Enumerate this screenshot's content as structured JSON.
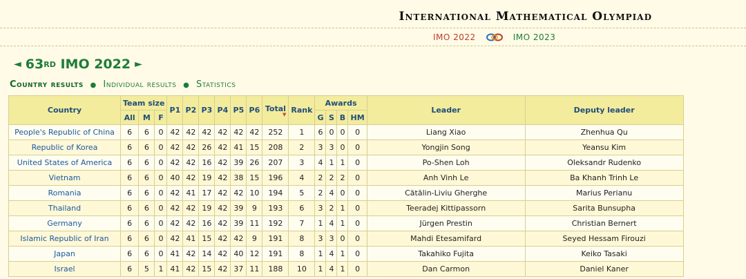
{
  "site_title": "International Mathematical Olympiad",
  "edition_nav": {
    "prev": "IMO 2022",
    "next": "IMO 2023"
  },
  "edition": {
    "ordinal": "63",
    "suffix": "RD",
    "label": "IMO 2022",
    "prev_arrow": "◄",
    "next_arrow": "►"
  },
  "section_nav": {
    "current": "Country results",
    "items": [
      "Individual results",
      "Statistics"
    ],
    "separator": "●"
  },
  "table": {
    "headers": {
      "country": "Country",
      "team_size": "Team size",
      "all": "All",
      "m": "M",
      "f": "F",
      "p1": "P1",
      "p2": "P2",
      "p3": "P3",
      "p4": "P4",
      "p5": "P5",
      "p6": "P6",
      "total": "Total",
      "rank": "Rank",
      "awards": "Awards",
      "g": "G",
      "s": "S",
      "b": "B",
      "hm": "HM",
      "leader": "Leader",
      "deputy": "Deputy leader"
    },
    "sort_marker": "▼",
    "rows": [
      {
        "country": "People's Republic of China",
        "all": "6",
        "m": "6",
        "f": "0",
        "p1": "42",
        "p2": "42",
        "p3": "42",
        "p4": "42",
        "p5": "42",
        "p6": "42",
        "total": "252",
        "rank": "1",
        "g": "6",
        "s": "0",
        "b": "0",
        "hm": "0",
        "leader": "Liang Xiao",
        "deputy": "Zhenhua Qu"
      },
      {
        "country": "Republic of Korea",
        "all": "6",
        "m": "6",
        "f": "0",
        "p1": "42",
        "p2": "42",
        "p3": "26",
        "p4": "42",
        "p5": "41",
        "p6": "15",
        "total": "208",
        "rank": "2",
        "g": "3",
        "s": "3",
        "b": "0",
        "hm": "0",
        "leader": "Yongjin Song",
        "deputy": "Yeansu Kim"
      },
      {
        "country": "United States of America",
        "all": "6",
        "m": "6",
        "f": "0",
        "p1": "42",
        "p2": "42",
        "p3": "16",
        "p4": "42",
        "p5": "39",
        "p6": "26",
        "total": "207",
        "rank": "3",
        "g": "4",
        "s": "1",
        "b": "1",
        "hm": "0",
        "leader": "Po-Shen Loh",
        "deputy": "Oleksandr Rudenko"
      },
      {
        "country": "Vietnam",
        "all": "6",
        "m": "6",
        "f": "0",
        "p1": "40",
        "p2": "42",
        "p3": "19",
        "p4": "42",
        "p5": "38",
        "p6": "15",
        "total": "196",
        "rank": "4",
        "g": "2",
        "s": "2",
        "b": "2",
        "hm": "0",
        "leader": "Anh Vinh Le",
        "deputy": "Ba Khanh Trinh Le"
      },
      {
        "country": "Romania",
        "all": "6",
        "m": "6",
        "f": "0",
        "p1": "42",
        "p2": "41",
        "p3": "17",
        "p4": "42",
        "p5": "42",
        "p6": "10",
        "total": "194",
        "rank": "5",
        "g": "2",
        "s": "4",
        "b": "0",
        "hm": "0",
        "leader": "Cătălin-Liviu Gherghe",
        "deputy": "Marius Perianu"
      },
      {
        "country": "Thailand",
        "all": "6",
        "m": "6",
        "f": "0",
        "p1": "42",
        "p2": "42",
        "p3": "19",
        "p4": "42",
        "p5": "39",
        "p6": "9",
        "total": "193",
        "rank": "6",
        "g": "3",
        "s": "2",
        "b": "1",
        "hm": "0",
        "leader": "Teeradej Kittipassorn",
        "deputy": "Sarita Bunsupha"
      },
      {
        "country": "Germany",
        "all": "6",
        "m": "6",
        "f": "0",
        "p1": "42",
        "p2": "42",
        "p3": "16",
        "p4": "42",
        "p5": "39",
        "p6": "11",
        "total": "192",
        "rank": "7",
        "g": "1",
        "s": "4",
        "b": "1",
        "hm": "0",
        "leader": "Jürgen Prestin",
        "deputy": "Christian Bernert"
      },
      {
        "country": "Islamic Republic of Iran",
        "all": "6",
        "m": "6",
        "f": "0",
        "p1": "42",
        "p2": "41",
        "p3": "15",
        "p4": "42",
        "p5": "42",
        "p6": "9",
        "total": "191",
        "rank": "8",
        "g": "3",
        "s": "3",
        "b": "0",
        "hm": "0",
        "leader": "Mahdi Etesamifard",
        "deputy": "Seyed Hessam Firouzi"
      },
      {
        "country": "Japan",
        "all": "6",
        "m": "6",
        "f": "0",
        "p1": "41",
        "p2": "42",
        "p3": "14",
        "p4": "42",
        "p5": "40",
        "p6": "12",
        "total": "191",
        "rank": "8",
        "g": "1",
        "s": "4",
        "b": "1",
        "hm": "0",
        "leader": "Takahiko Fujita",
        "deputy": "Keiko Tasaki"
      },
      {
        "country": "Israel",
        "all": "6",
        "m": "5",
        "f": "1",
        "p1": "41",
        "p2": "42",
        "p3": "15",
        "p4": "42",
        "p5": "37",
        "p6": "11",
        "total": "188",
        "rank": "10",
        "g": "1",
        "s": "4",
        "b": "1",
        "hm": "0",
        "leader": "Dan Carmon",
        "deputy": "Daniel Kaner"
      }
    ]
  }
}
